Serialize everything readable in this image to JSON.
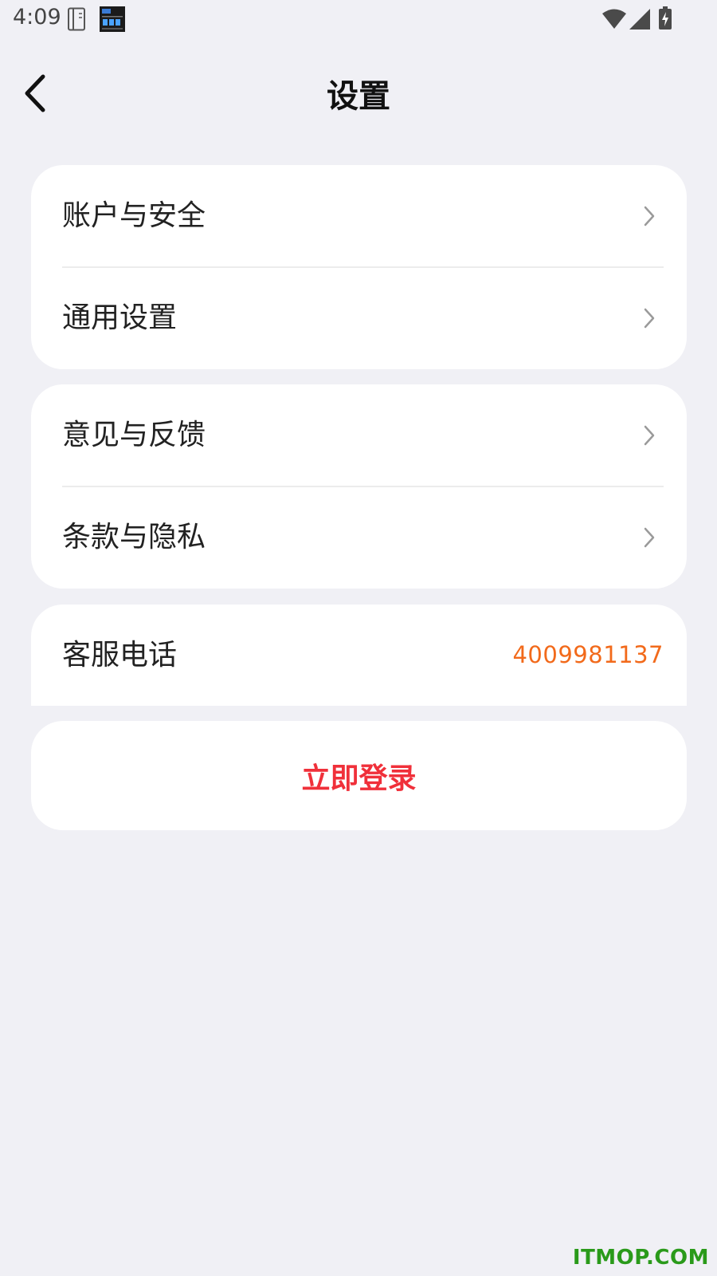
{
  "status_bar": {
    "time": "4:09",
    "icons": [
      "notebook-icon",
      "clock-widget-icon",
      "wifi-icon",
      "signal-icon",
      "battery-charging-icon"
    ]
  },
  "header": {
    "title": "设置",
    "back_icon": "chevron-left-icon"
  },
  "groups": [
    {
      "items": [
        {
          "label": "账户与安全"
        },
        {
          "label": "通用设置"
        }
      ]
    },
    {
      "items": [
        {
          "label": "意见与反馈"
        },
        {
          "label": "条款与隐私"
        }
      ]
    }
  ],
  "customer_service": {
    "label": "客服电话",
    "phone": "4009981137",
    "phone_color": "#f26a1b"
  },
  "login": {
    "label": "立即登录",
    "color": "#f0303a"
  },
  "watermark": "ITMOP.COM",
  "colors": {
    "background": "#f0f0f5",
    "card": "#ffffff",
    "chevron": "#9a9a9a"
  }
}
